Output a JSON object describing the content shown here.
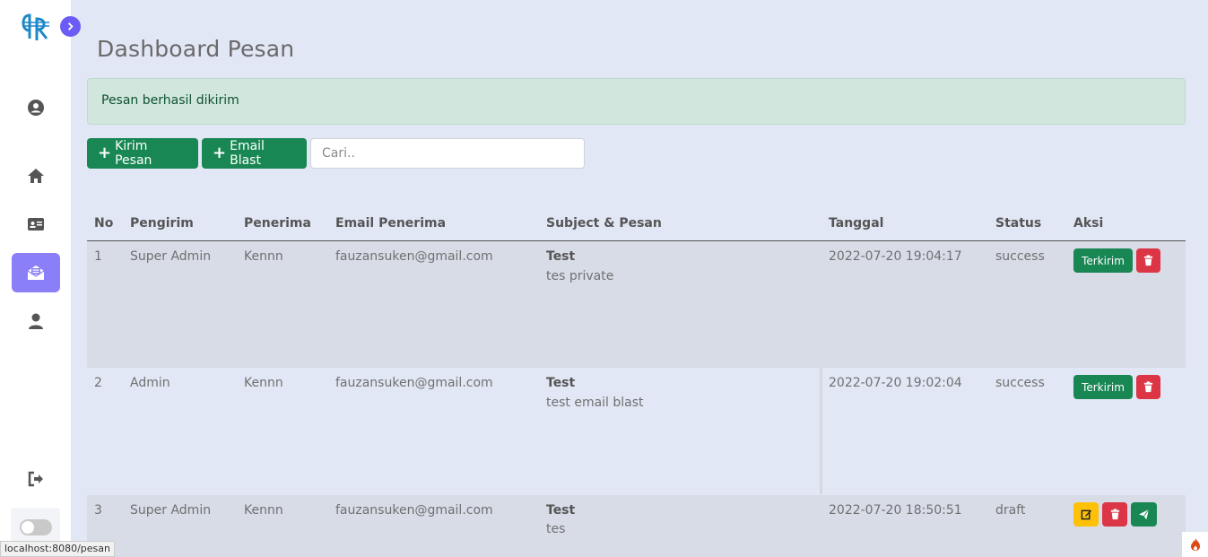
{
  "page": {
    "title": "Dashboard Pesan",
    "alert": "Pesan berhasil dikirim"
  },
  "toolbar": {
    "kirim_label": "Kirim Pesan",
    "blast_label": "Email Blast",
    "search_placeholder": "Cari.."
  },
  "table": {
    "headers": [
      "No",
      "Pengirim",
      "Penerima",
      "Email Penerima",
      "Subject & Pesan",
      "Tanggal",
      "Status",
      "Aksi"
    ],
    "rows": [
      {
        "no": "1",
        "pengirim": "Super Admin",
        "penerima": "Kennn",
        "email": "fauzansuken@gmail.com",
        "subject": "Test",
        "pesan": "tes private",
        "tanggal": "2022-07-20 19:04:17",
        "status": "success",
        "aksi_label": "Terkirim"
      },
      {
        "no": "2",
        "pengirim": "Admin",
        "penerima": "Kennn",
        "email": "fauzansuken@gmail.com",
        "subject": "Test",
        "pesan": "test email blast",
        "tanggal": "2022-07-20 19:02:04",
        "status": "success",
        "aksi_label": "Terkirim"
      },
      {
        "no": "3",
        "pengirim": "Super Admin",
        "penerima": "Kennn",
        "email": "fauzansuken@gmail.com",
        "subject": "Test",
        "pesan": "tes",
        "tanggal": "2022-07-20 18:50:51",
        "status": "draft"
      }
    ]
  },
  "statusbar": "localhost:8080/pesan",
  "colors": {
    "accent": "#6a5cf5",
    "active_nav": "#8b7ff7",
    "success": "#198754",
    "danger": "#dc3545",
    "warning": "#ffc107"
  },
  "icons": {
    "sidebar": [
      "user-circle-icon",
      "home-icon",
      "id-card-icon",
      "envelope-open-icon",
      "user-icon",
      "logout-icon"
    ]
  }
}
